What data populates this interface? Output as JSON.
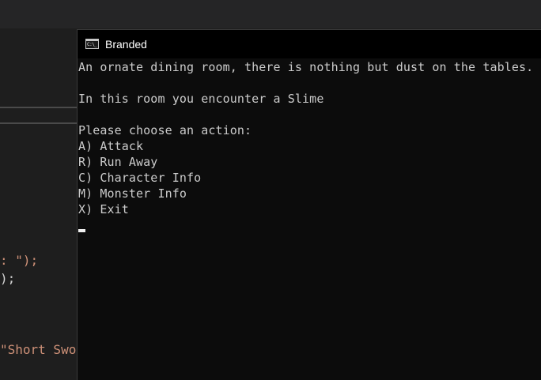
{
  "editor": {
    "code_line_1": ": \");",
    "code_line_2": ");",
    "code_line_3": "\"Short Swor"
  },
  "window": {
    "title": "Branded",
    "icon": "console-icon",
    "icon_text": "C:\\_"
  },
  "console": {
    "room_description": "An ornate dining room, there is nothing but dust on the tables.",
    "encounter": "In this room you encounter a Slime",
    "prompt": "Please choose an action:",
    "options": [
      "A) Attack",
      "R) Run Away",
      "C) Character Info",
      "M) Monster Info",
      "X) Exit"
    ]
  }
}
